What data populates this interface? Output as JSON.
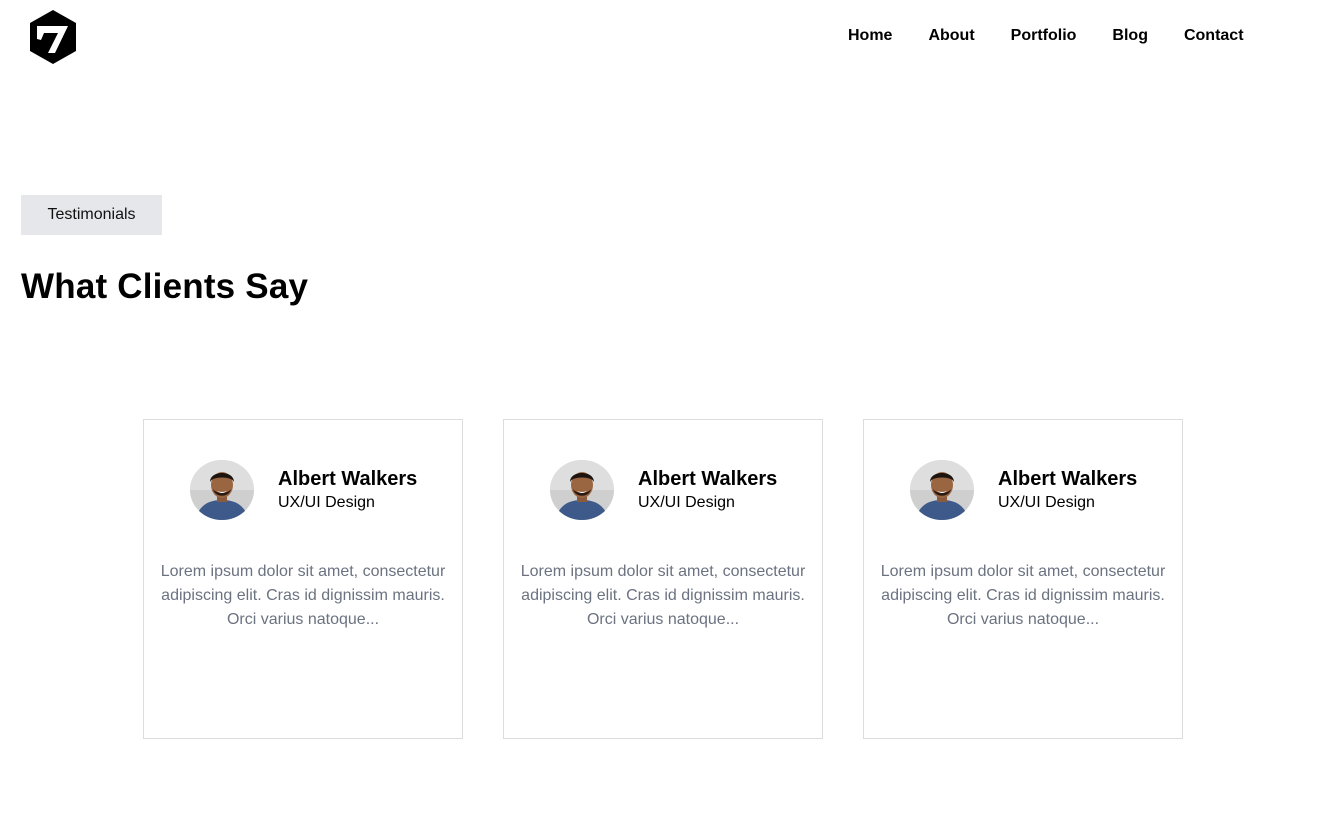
{
  "nav": {
    "items": [
      {
        "label": "Home"
      },
      {
        "label": "About"
      },
      {
        "label": "Portfolio"
      },
      {
        "label": "Blog"
      },
      {
        "label": "Contact"
      }
    ]
  },
  "logo": {
    "icon": "hexagon-seven-logo"
  },
  "section": {
    "tag": "Testimonials",
    "title": "What Clients Say"
  },
  "testimonials": [
    {
      "name": "Albert Walkers",
      "role": "UX/UI Design",
      "text": "Lorem ipsum dolor sit amet, consectetur adipiscing elit. Cras id dignissim mauris. Orci varius natoque...",
      "avatar": "avatar-photo"
    },
    {
      "name": "Albert Walkers",
      "role": "UX/UI Design",
      "text": "Lorem ipsum dolor sit amet, consectetur adipiscing elit. Cras id dignissim mauris. Orci varius natoque...",
      "avatar": "avatar-photo"
    },
    {
      "name": "Albert Walkers",
      "role": "UX/UI Design",
      "text": "Lorem ipsum dolor sit amet, consectetur adipiscing elit. Cras id dignissim mauris. Orci varius natoque...",
      "avatar": "avatar-photo"
    }
  ],
  "colors": {
    "tag_background": "#e5e7eb",
    "card_border": "#dcdcdc",
    "quote_text": "#6b7280"
  }
}
